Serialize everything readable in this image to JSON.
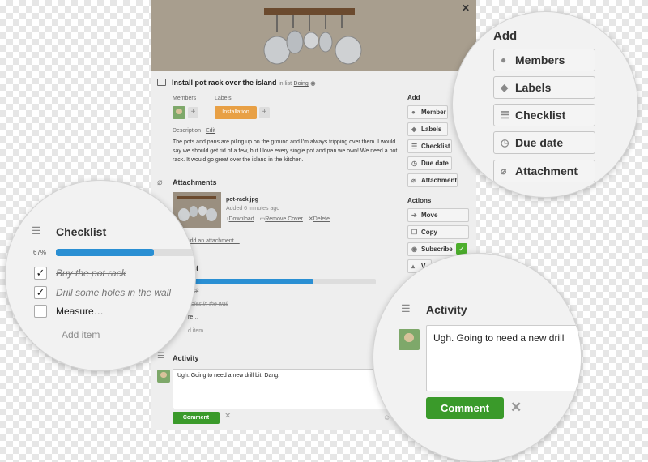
{
  "card": {
    "title": "Install pot rack over the island",
    "list_prefix": "in list",
    "list_name": "Doing",
    "members_label": "Members",
    "labels_label": "Labels",
    "label_tag": "Installation",
    "description_label": "Description",
    "edit_link": "Edit",
    "description": "The pots and pans are piling up on the ground and I'm always tripping over them. I would say we should get rid of a few, but I love every single pot and pan we own! We need a pot rack. It would go great over the island in the kitchen.",
    "attachments_title": "Attachments",
    "attachment": {
      "filename": "pot-rack.jpg",
      "added": "Added 6 minutes ago",
      "download": "Download",
      "remove_cover": "Remove Cover",
      "delete": "Delete"
    },
    "add_attachment": "Add an attachment…",
    "checklist_title_partial": "list",
    "checklist_items_partial": [
      "rack",
      "holes in the wall",
      "re…"
    ],
    "add_item_partial": "d item",
    "activity_title": "Activity",
    "comment_text": "Ugh. Going to need a new drill bit. Dang.",
    "comment_button": "Comment",
    "sidebar": {
      "add_title": "Add",
      "add_buttons": [
        "Member",
        "Labels",
        "Checklist",
        "Due date",
        "Attachment"
      ],
      "actions_title": "Actions",
      "action_buttons": [
        "Move",
        "Copy",
        "Subscribe",
        "V…"
      ]
    }
  },
  "zoom_add": {
    "title": "Add",
    "buttons": [
      "Members",
      "Labels",
      "Checklist",
      "Due date",
      "Attachment"
    ]
  },
  "zoom_checklist": {
    "title": "Checklist",
    "percent": "67%",
    "progress": 0.67,
    "items": [
      {
        "text": "Buy the pot rack",
        "done": true
      },
      {
        "text": "Drill some holes in the wall",
        "done": true
      },
      {
        "text": "Measure…",
        "done": false
      }
    ],
    "add_item": "Add item"
  },
  "zoom_activity": {
    "title": "Activity",
    "comment_text": "Ugh. Going to need a new drill",
    "comment_button": "Comment"
  },
  "colors": {
    "label_orange": "#e8a045",
    "progress_blue": "#2a8fd3",
    "comment_green": "#3a9a2a",
    "subscribe_green": "#4cae2c"
  }
}
